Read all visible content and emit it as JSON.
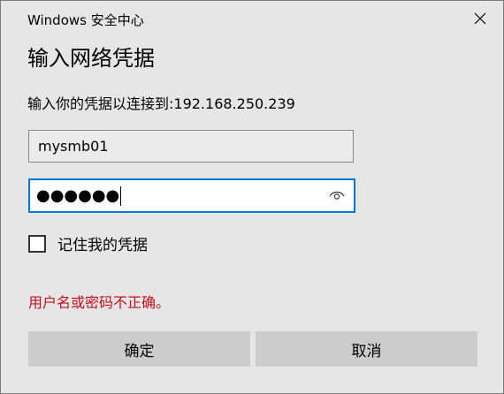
{
  "window": {
    "title": "Windows 安全中心",
    "close_icon": "close-icon"
  },
  "dialog": {
    "heading": "输入网络凭据",
    "prompt": "输入你的凭据以连接到:192.168.250.239"
  },
  "username": {
    "value": "mysmb01"
  },
  "password": {
    "masked_value": "●●●●●●",
    "reveal_icon": "eye-icon"
  },
  "remember": {
    "label": "记住我的凭据",
    "checked": false
  },
  "error": {
    "message": "用户名或密码不正确。",
    "color": "#c50f1f"
  },
  "buttons": {
    "ok_label": "确定",
    "cancel_label": "取消"
  },
  "colors": {
    "background": "#e6e6e6",
    "focus_border": "#0078d7",
    "button_bg": "#cccccc"
  }
}
